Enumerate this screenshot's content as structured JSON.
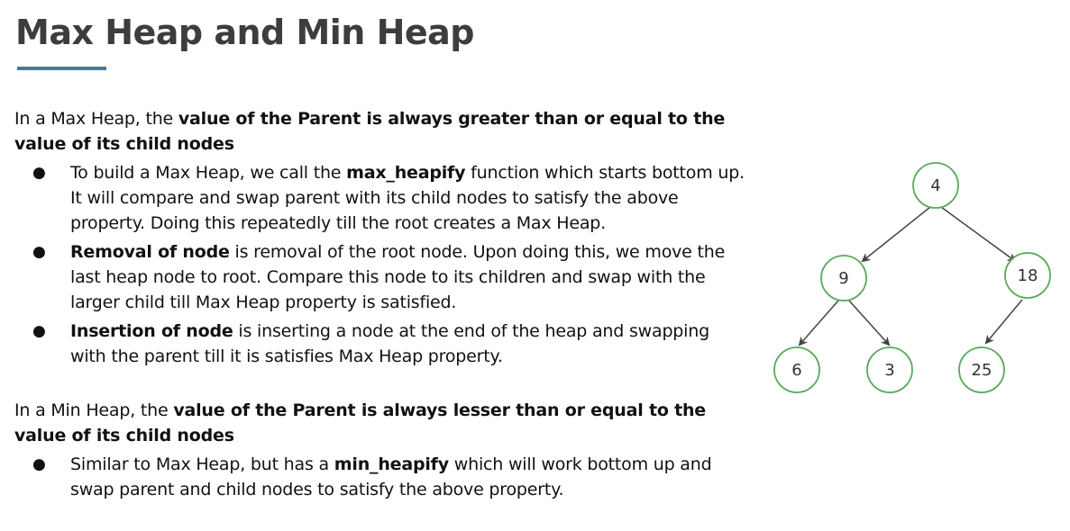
{
  "title": "Max Heap and Min Heap",
  "max_heap": {
    "intro_prefix": "In a Max Heap, the ",
    "intro_bold": "value of the Parent is always greater than or equal to the value of its child nodes",
    "bullets": [
      {
        "pre": "To build a Max Heap, we call the ",
        "bold": "max_heapify",
        "post": " function which starts bottom up. It will compare and swap parent with its child nodes to satisfy the above property. Doing this repeatedly till the root creates a Max Heap."
      },
      {
        "pre": "",
        "bold": "Removal of node",
        "post": " is removal of the root node. Upon doing this, we move the last heap node to root. Compare this node to its children and swap with the larger child till Max Heap property is satisfied."
      },
      {
        "pre": "",
        "bold": "Insertion of node",
        "post": " is inserting a node at the end of the heap and swapping with the parent till it is satisfies Max Heap property."
      }
    ]
  },
  "min_heap": {
    "intro_prefix": "In a Min Heap, the ",
    "intro_bold": "value of the Parent is always lesser than or equal to the value of its child nodes",
    "bullets": [
      {
        "pre": "Similar to Max Heap, but has a ",
        "bold": "min_heapify",
        "post": " which will work bottom up and swap parent and child nodes to satisfy the above property."
      }
    ]
  },
  "bullet_symbol": "●",
  "tree": {
    "node_color": "#5aa95a",
    "nodes": {
      "root": "4",
      "left": "9",
      "right": "18",
      "left_left": "6",
      "left_right": "3",
      "right_left": "25"
    }
  }
}
